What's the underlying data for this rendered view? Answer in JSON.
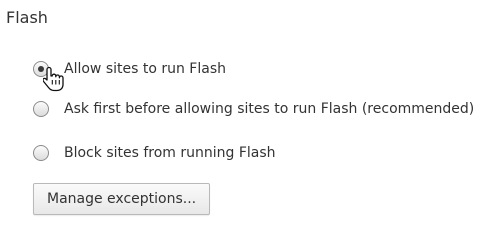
{
  "section": {
    "title": "Flash"
  },
  "options": [
    {
      "label": "Allow sites to run Flash",
      "selected": true
    },
    {
      "label": "Ask first before allowing sites to run Flash (recommended)",
      "selected": false
    },
    {
      "label": "Block sites from running Flash",
      "selected": false
    }
  ],
  "manage_button": {
    "label": "Manage exceptions..."
  },
  "cursor": {
    "icon": "hand-pointer-icon"
  }
}
